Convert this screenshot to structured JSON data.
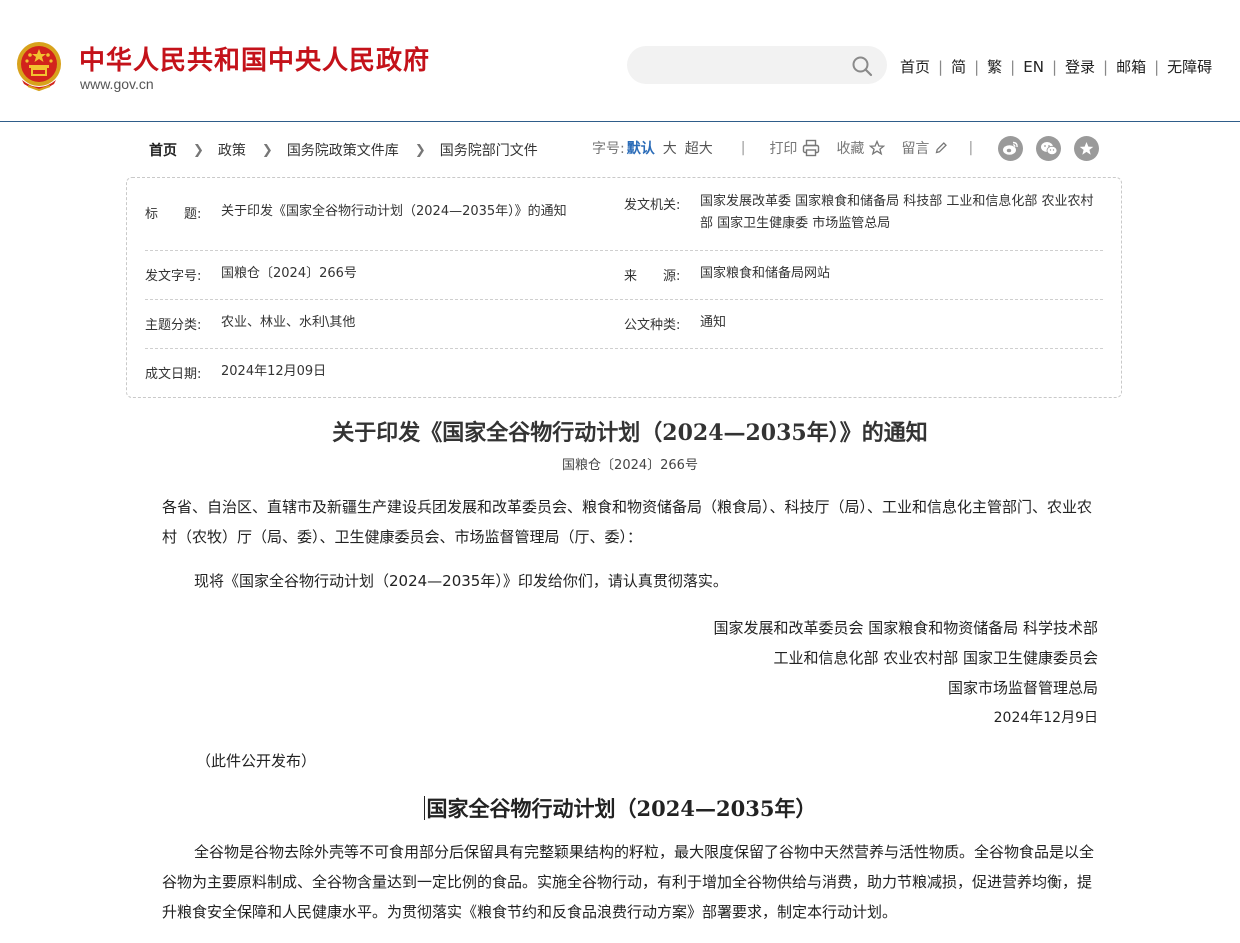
{
  "header": {
    "site_title": "中华人民共和国中央人民政府",
    "site_url": "www.gov.cn",
    "search_placeholder": "",
    "nav": [
      "首页",
      "简",
      "繁",
      "EN",
      "登录",
      "邮箱",
      "无障碍"
    ],
    "separator": "|"
  },
  "breadcrumb": {
    "items": [
      "首页",
      "政策",
      "国务院政策文件库",
      "国务院部门文件"
    ]
  },
  "toolbar": {
    "font_size_label": "字号:",
    "font_sizes": [
      "默认",
      "大",
      "超大"
    ],
    "print_label": "打印",
    "favorite_label": "收藏",
    "comment_label": "留言",
    "share_icons": [
      "weibo-icon",
      "wechat-icon",
      "star-share-icon"
    ]
  },
  "info": {
    "title_key": "标　　题:",
    "title_val": "关于印发《国家全谷物行动计划（2024—2035年）》的通知",
    "issuer_key": "发文机关:",
    "issuer_val": "国家发展改革委 国家粮食和储备局 科技部 工业和信息化部 农业农村部 国家卫生健康委 市场监管总局",
    "docno_key": "发文字号:",
    "docno_val": "国粮仓〔2024〕266号",
    "source_key": "来　　源:",
    "source_val": "国家粮食和储备局网站",
    "topic_key": "主题分类:",
    "topic_val": "农业、林业、水利\\其他",
    "type_key": "公文种类:",
    "type_val": "通知",
    "date_key": "成文日期:",
    "date_val": "2024年12月09日"
  },
  "article": {
    "title": "关于印发《国家全谷物行动计划（2024—2035年）》的通知",
    "doc_no": "国粮仓〔2024〕266号",
    "addressee": "各省、自治区、直辖市及新疆生产建设兵团发展和改革委员会、粮食和物资储备局（粮食局）、科技厅（局）、工业和信息化主管部门、农业农村（农牧）厅（局、委）、卫生健康委员会、市场监督管理局（厅、委）：",
    "body": "现将《国家全谷物行动计划（2024—2035年）》印发给你们，请认真贯彻落实。",
    "signers": [
      "国家发展和改革委员会 国家粮食和物资储备局 科学技术部",
      "工业和信息化部 农业农村部 国家卫生健康委员会",
      "国家市场监督管理总局"
    ],
    "sign_date": "2024年12月9日",
    "publish_note": "（此件公开发布）",
    "plan_title": "国家全谷物行动计划（2024—2035年）",
    "plan_intro": "全谷物是谷物去除外壳等不可食用部分后保留具有完整颖果结构的籽粒，最大限度保留了谷物中天然营养与活性物质。全谷物食品是以全谷物为主要原料制成、全谷物含量达到一定比例的食品。实施全谷物行动，有利于增加全谷物供给与消费，助力节粮减损，促进营养均衡，提升粮食安全保障和人民健康水平。为贯彻落实《粮食节约和反食品浪费行动方案》部署要求，制定本行动计划。"
  },
  "colors": {
    "brand_red": "#c4121a",
    "link_blue": "#2b6cb8",
    "header_rule": "#2f5d8a"
  }
}
